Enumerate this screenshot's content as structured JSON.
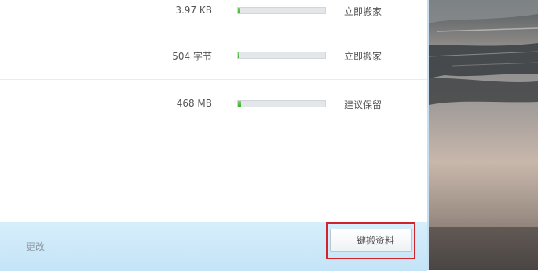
{
  "files": [
    {
      "size": "3.97 KB",
      "progress": 0.01,
      "advice": "立即搬家"
    },
    {
      "size": "504 字节",
      "progress": 0.0,
      "advice": "立即搬家"
    },
    {
      "size": "468 MB",
      "progress": 0.04,
      "advice": "建议保留"
    }
  ],
  "footer": {
    "change_label": "更改",
    "action_label": "一键搬资料"
  },
  "colors": {
    "progress_fill": "#4cb83a",
    "highlight_border": "#d0232b",
    "footer_bg": "#cfe9f9"
  },
  "icons": {
    "background_photo": "lake-landscape-image"
  }
}
